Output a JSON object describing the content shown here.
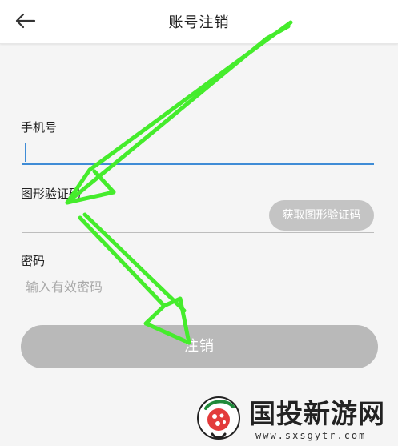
{
  "header": {
    "title": "账号注销",
    "back_icon": "back-arrow-icon"
  },
  "form": {
    "phone": {
      "label": "手机号",
      "value": "",
      "placeholder": ""
    },
    "captcha": {
      "label": "图形验证码",
      "value": "",
      "placeholder": "",
      "button_label": "获取图形验证码"
    },
    "password": {
      "label": "密码",
      "value": "",
      "placeholder": "输入有效密码"
    },
    "submit_label": "注销"
  },
  "watermark": {
    "name": "国投新游网",
    "url": "www.sxsgytr.com"
  },
  "colors": {
    "accent": "#3f8cd6",
    "button_disabled": "#b9b9b9",
    "captcha_button": "#c4c4c4",
    "annotation_arrow": "#45ec2c"
  }
}
